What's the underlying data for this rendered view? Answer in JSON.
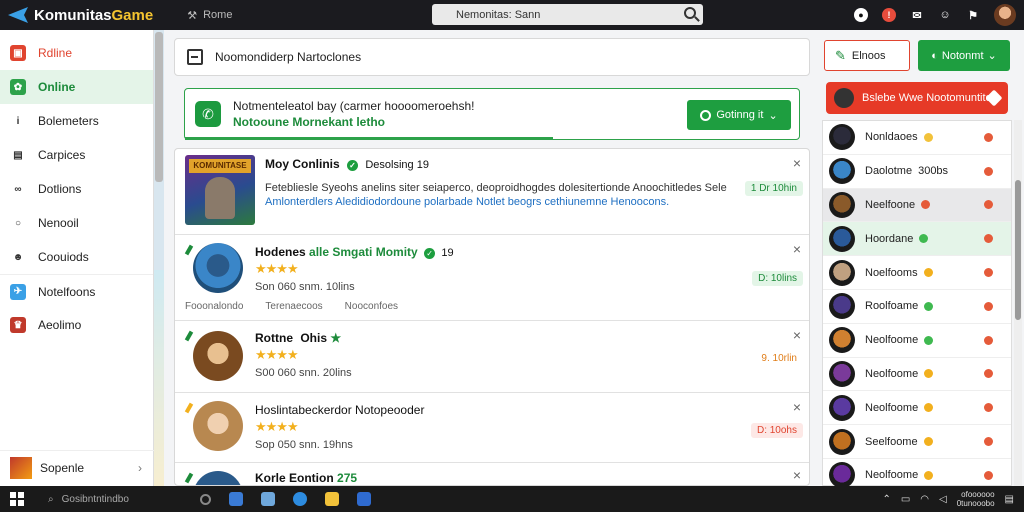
{
  "app": {
    "title": "Komunitas Game",
    "title_main": "Komunitas",
    "title_accent": " Game",
    "nav_label": "Rome"
  },
  "search": {
    "text": "Nemonitas: Sann"
  },
  "sidebar": {
    "items": [
      {
        "label": "Rdline",
        "icon": "home-icon",
        "color": "#e0442f"
      },
      {
        "label": "Online",
        "icon": "online-icon",
        "active": true
      },
      {
        "label": "Bolemeters",
        "icon": "info-icon"
      },
      {
        "label": "Carpices",
        "icon": "chart-icon"
      },
      {
        "label": "Dotlions",
        "icon": "controller-icon"
      },
      {
        "label": "Nenooil",
        "icon": "user-icon"
      },
      {
        "label": "Coouiods",
        "icon": "group-icon"
      },
      {
        "label": "Notelfoons",
        "icon": "bell-icon"
      },
      {
        "label": "Aeolimo",
        "icon": "game-icon"
      }
    ],
    "bottom": {
      "label": "Sopenle"
    }
  },
  "header": {
    "title": "Noomondiderp Nartoclones"
  },
  "notification": {
    "line1": "Notmenteleatol bay (carmer hoooomeroehsh!",
    "line2": "Notooune Mornekant letho",
    "button": "Gotinng it",
    "progress": 0.6
  },
  "posts": [
    {
      "title": "Moy Conlinis",
      "tail": "Desolsing 19",
      "banner": "KOMUNITASE",
      "body": "Fetebliesle Syeohs anelins siter seiaperco, deoproidhogdes dolesitertionde Anoochitledes Sele",
      "body_link": "Amlonterdlers Aledidiodordoune polarbade Notlet beogrs cethiunemne Henoocons.",
      "tag": "1 Dr 10hin"
    },
    {
      "title": "Hodenes",
      "title2": "alle Smgati Momity",
      "title3": "19",
      "stars": 3,
      "meta1": "Son 060 snm. 10lins",
      "footer": [
        "Fooonalondo",
        "Terenaecoos",
        "Nooconfoes"
      ],
      "tag": "D: 10lins"
    },
    {
      "title": "Rottne",
      "title2": "Ohis",
      "stars": 3,
      "meta1": "S00 060 snn. 20lins",
      "tag": "9. 10rlin"
    },
    {
      "title": "Hoslintabeckerdor Notopeooder",
      "stars": 3,
      "meta1": "Sop 050 snn. 19hns",
      "tag": "D: 10ohs"
    },
    {
      "title": "Korle Eontion",
      "title2": "275"
    }
  ],
  "right": {
    "btn1": "Elnoos",
    "btn2": "Notonmt",
    "banner": "Bslebe Wwe Nootomuntites",
    "list": [
      {
        "name": "Nonldaoes",
        "dot": "#f2c23a"
      },
      {
        "name": "Daolotme",
        "extra": "300bs"
      },
      {
        "name": "Neelfoone",
        "dot": "#e55b3a",
        "hl": 1
      },
      {
        "name": "Hoordane",
        "dot": "#3fb950",
        "hl": 2
      },
      {
        "name": "Noelfooms",
        "dot": "#f2b01e"
      },
      {
        "name": "Roolfoame",
        "dot": "#3fb950"
      },
      {
        "name": "Neolfoome",
        "dot": "#3fb950"
      },
      {
        "name": "Neolfoome",
        "dot": "#f2b01e"
      },
      {
        "name": "Neolfoome",
        "dot": "#f2b01e"
      },
      {
        "name": "Seelfoome",
        "dot": "#f2b01e"
      },
      {
        "name": "Neolfoome",
        "dot": "#f2b01e"
      }
    ]
  },
  "taskbar": {
    "search": "Gosibntntindbo",
    "clock1": "ofoooooo",
    "clock2": "0tunooobo"
  }
}
